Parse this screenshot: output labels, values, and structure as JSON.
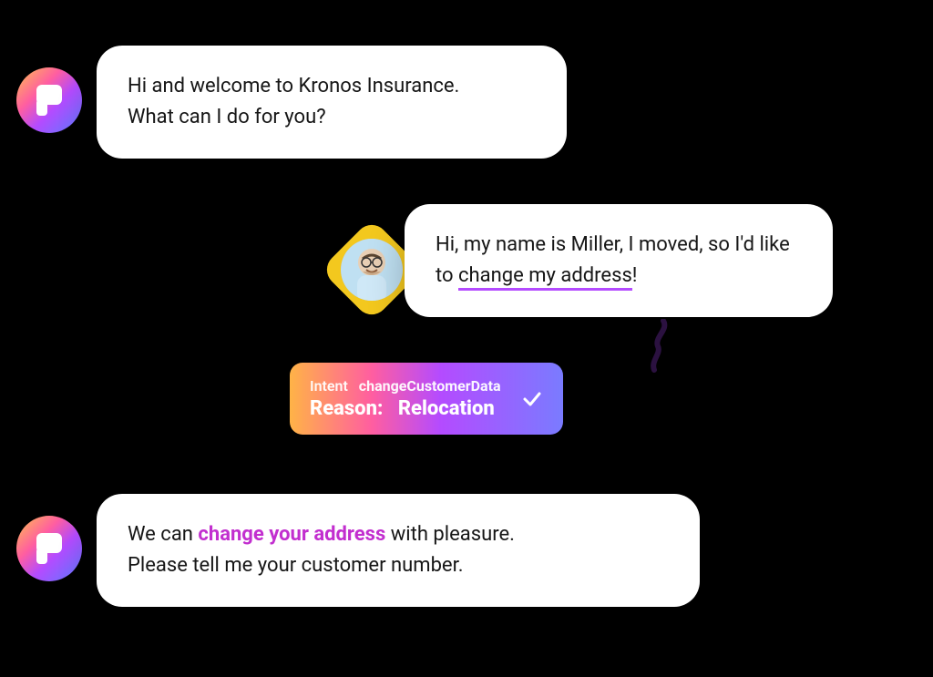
{
  "bot_message_1": {
    "line1": "Hi and welcome to Kronos Insurance.",
    "line2": "What can I do for you?"
  },
  "user_message": {
    "prefix": "Hi, my name is Miller, I moved, so I'd like to ",
    "highlight": "change my address",
    "suffix": "!"
  },
  "intent": {
    "intent_label": "Intent",
    "intent_name": "changeCustomerData",
    "reason_label": "Reason:",
    "reason_value": "Relocation"
  },
  "bot_message_2": {
    "prefix": "We can ",
    "highlight": "change your address",
    "mid": " with pleasure.",
    "line2": "Please tell me your customer number."
  }
}
